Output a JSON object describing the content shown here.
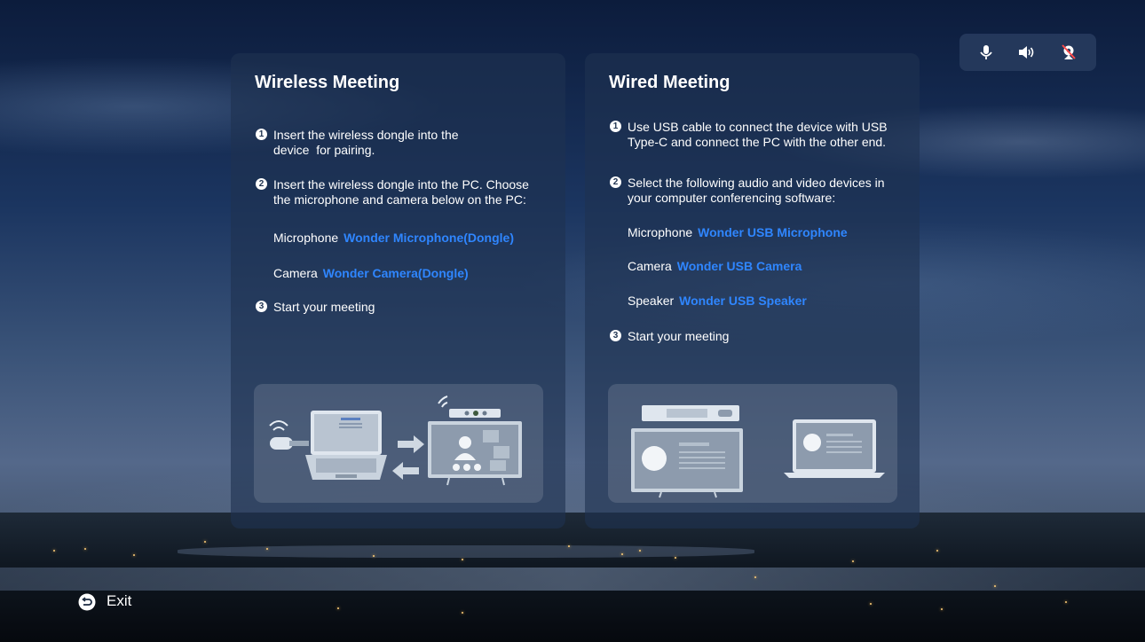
{
  "wireless": {
    "title": "Wireless Meeting",
    "steps": [
      {
        "num": "1",
        "text": "Insert the wireless dongle into the device  for pairing."
      },
      {
        "num": "2",
        "text": "Insert the wireless dongle into the PC. Choose the microphone and camera below on the PC:"
      },
      {
        "num": "3",
        "text": "Start your meeting"
      }
    ],
    "devices": [
      {
        "label": "Microphone",
        "value": "Wonder Microphone(Dongle)"
      },
      {
        "label": "Camera",
        "value": "Wonder Camera(Dongle)"
      }
    ]
  },
  "wired": {
    "title": "Wired Meeting",
    "steps": [
      {
        "num": "1",
        "text": "Use USB cable to connect the device with USB Type-C and connect the PC with the other end."
      },
      {
        "num": "2",
        "text": "Select the following audio and video devices in your computer conferencing software:"
      },
      {
        "num": "3",
        "text": "Start your meeting"
      }
    ],
    "devices": [
      {
        "label": "Microphone",
        "value": "Wonder USB Microphone"
      },
      {
        "label": "Camera",
        "value": "Wonder USB Camera"
      },
      {
        "label": "Speaker",
        "value": "Wonder USB Speaker"
      }
    ]
  },
  "topbar": {
    "icons": [
      "microphone-icon",
      "speaker-volume-icon",
      "camera-off-icon"
    ]
  },
  "exit": {
    "label": "Exit",
    "icon": "return-icon"
  },
  "colors": {
    "accent": "#2f86ff",
    "card": "#1e3250"
  }
}
